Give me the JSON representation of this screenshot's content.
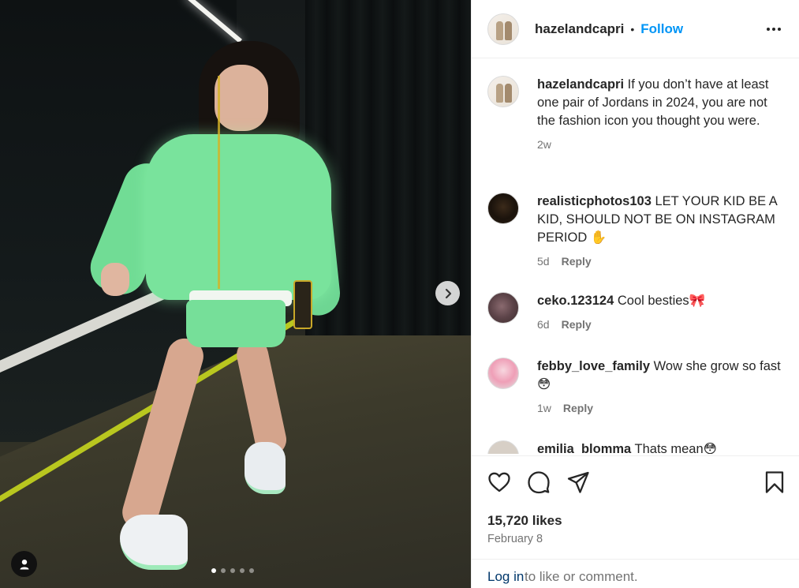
{
  "post": {
    "username": "hazelandcapri",
    "separator": "•",
    "follow_label": "Follow",
    "caption": "If you don’t have at least one pair of Jordans in 2024, you are not the fashion icon you thought you were.",
    "caption_age": "2w",
    "carousel": {
      "total_slides": 5,
      "active_slide": 1
    }
  },
  "comments": [
    {
      "username": "realisticphotos103",
      "text": "LET YOUR KID BE A KID, SHOULD NOT BE ON INSTAGRAM PERIOD ✋",
      "age": "5d",
      "reply_label": "Reply",
      "avatar_icon": "black-cat-avatar"
    },
    {
      "username": "ceko.123124",
      "text": "Cool besties🎀",
      "age": "6d",
      "reply_label": "Reply",
      "avatar_icon": "plant-avatar"
    },
    {
      "username": "febby_love_family",
      "text": "Wow she grow so fast 😳",
      "age": "1w",
      "reply_label": "Reply",
      "avatar_icon": "girl-avatar"
    },
    {
      "username": "emilia_blomma",
      "text": "Thats mean😳",
      "age": "",
      "reply_label": "",
      "avatar_icon": "person-avatar"
    }
  ],
  "footer": {
    "likes": "15,720 likes",
    "date": "February 8",
    "login_link": "Log in",
    "login_rest": "to like or comment."
  },
  "colors": {
    "link_blue": "#0095f6",
    "text_dark": "#262626",
    "text_muted": "#737373",
    "login_link": "#00376b"
  }
}
